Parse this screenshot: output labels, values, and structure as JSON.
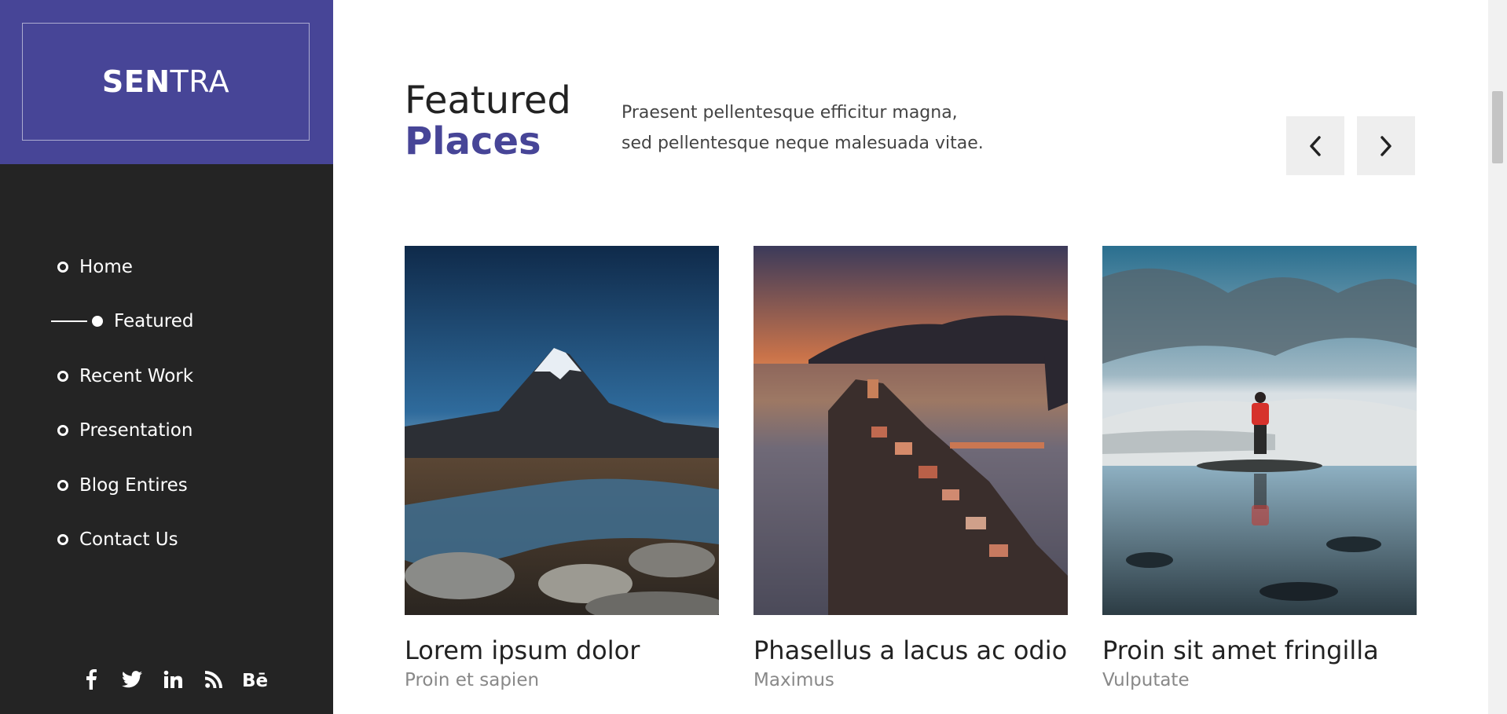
{
  "brand": {
    "strong": "SEN",
    "light": "TRA"
  },
  "nav": {
    "items": [
      {
        "label": "Home"
      },
      {
        "label": "Featured"
      },
      {
        "label": "Recent Work"
      },
      {
        "label": "Presentation"
      },
      {
        "label": "Blog Entires"
      },
      {
        "label": "Contact Us"
      }
    ],
    "active_index": 1
  },
  "social": [
    "facebook-icon",
    "twitter-icon",
    "linkedin-icon",
    "rss-icon",
    "behance-icon"
  ],
  "section": {
    "title_plain": "Featured",
    "title_accent": "Places",
    "intro_line1": "Praesent pellentesque efficitur magna,",
    "intro_line2": "sed pellentesque neque malesuada vitae."
  },
  "controls": {
    "prev_icon": "chevron-left-icon",
    "next_icon": "chevron-right-icon"
  },
  "cards": [
    {
      "title": "Lorem ipsum dolor",
      "subtitle": "Proin et sapien"
    },
    {
      "title": "Phasellus a lacus ac odio",
      "subtitle": "Maximus"
    },
    {
      "title": "Proin sit amet fringilla",
      "subtitle": "Vulputate"
    }
  ],
  "colors": {
    "accent": "#474597",
    "sidebar": "#242424",
    "button": "#eeeeee"
  }
}
